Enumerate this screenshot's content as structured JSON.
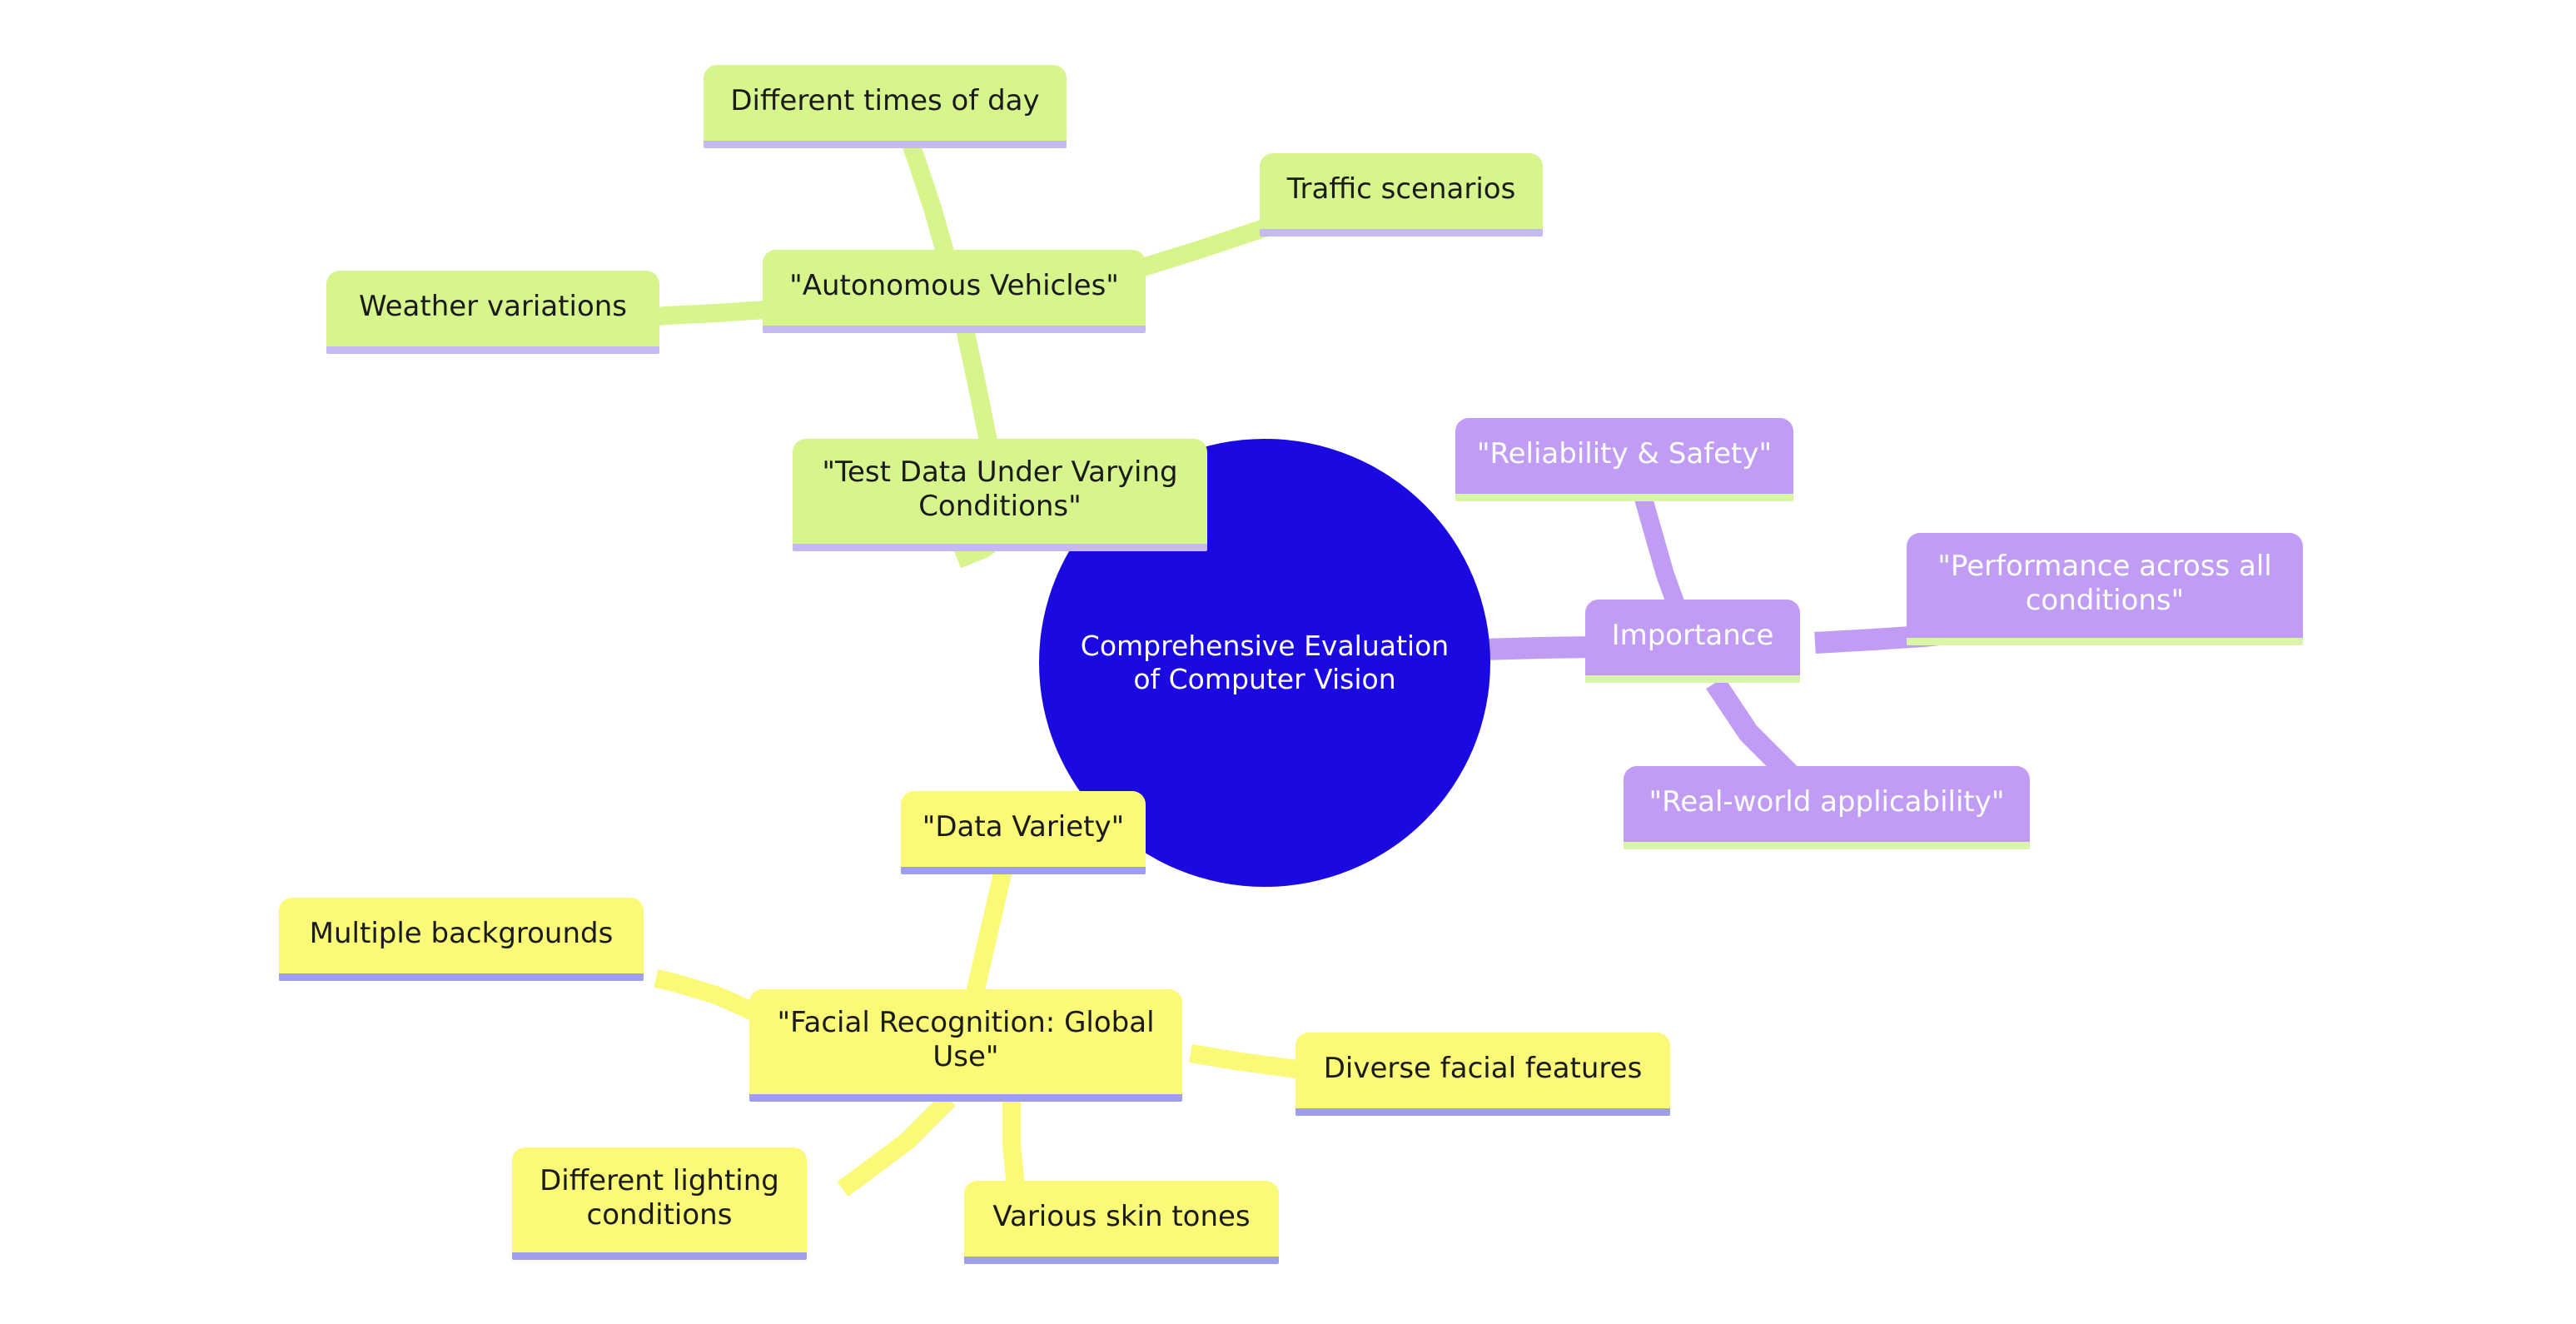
{
  "diagram": {
    "type": "mind-map",
    "background_color": "#ffffff",
    "root": {
      "label": "Comprehensive Evaluation\nof Computer Vision",
      "shape": "circle",
      "fill_color": "#1a09e0",
      "text_color": "#ffffff"
    },
    "branches": [
      {
        "id": "test-data",
        "label": "\"Test Data Under Varying\nConditions\"",
        "fill_color": "#d6f58c",
        "text_color": "#1a1a1a",
        "underline_color": "#c6b8f0",
        "children": [
          {
            "id": "autonomous-vehicles",
            "label": "\"Autonomous Vehicles\"",
            "children": [
              {
                "id": "different-times-of-day",
                "label": "Different times of day"
              },
              {
                "id": "traffic-scenarios",
                "label": "Traffic scenarios"
              },
              {
                "id": "weather-variations",
                "label": "Weather variations"
              }
            ]
          }
        ]
      },
      {
        "id": "data-variety",
        "label": "\"Data Variety\"",
        "fill_color": "#fafa78",
        "text_color": "#1a1a1a",
        "underline_color": "#9e9eea",
        "children": [
          {
            "id": "facial-recognition",
            "label": "\"Facial Recognition: Global\nUse\"",
            "children": [
              {
                "id": "multiple-backgrounds",
                "label": "Multiple backgrounds"
              },
              {
                "id": "diverse-facial-features",
                "label": "Diverse facial features"
              },
              {
                "id": "different-lighting-conditions",
                "label": "Different lighting\nconditions"
              },
              {
                "id": "various-skin-tones",
                "label": "Various skin tones"
              }
            ]
          }
        ]
      },
      {
        "id": "importance",
        "label": "Importance",
        "fill_color": "#c09cf5",
        "text_color": "#ffffff",
        "underline_color": "#d9f5a8",
        "children": [
          {
            "id": "reliability-safety",
            "label": "\"Reliability & Safety\""
          },
          {
            "id": "performance-across-all-conditions",
            "label": "\"Performance across all\nconditions\""
          },
          {
            "id": "real-world-applicability",
            "label": "\"Real-world applicability\""
          }
        ]
      }
    ]
  },
  "nodes": {
    "root": "Comprehensive Evaluation\nof Computer Vision",
    "different_times_of_day": "Different times of day",
    "traffic_scenarios": "Traffic scenarios",
    "weather_variations": "Weather variations",
    "autonomous_vehicles": "\"Autonomous Vehicles\"",
    "test_data_under_varying_conditions": "\"Test Data Under Varying\nConditions\"",
    "reliability_safety": "\"Reliability & Safety\"",
    "importance": "Importance",
    "performance_across_all_conditions": "\"Performance across all\nconditions\"",
    "real_world_applicability": "\"Real-world applicability\"",
    "data_variety": "\"Data Variety\"",
    "multiple_backgrounds": "Multiple backgrounds",
    "facial_recognition_global_use": "\"Facial Recognition: Global\nUse\"",
    "diverse_facial_features": "Diverse facial features",
    "different_lighting_conditions": "Different lighting\nconditions",
    "various_skin_tones": "Various skin tones"
  },
  "colors": {
    "root_fill": "#1a09e0",
    "green_fill": "#d6f58c",
    "green_underline": "#c6b8f0",
    "yellow_fill": "#fafa78",
    "yellow_underline": "#9e9eea",
    "purple_fill": "#c09cf5",
    "purple_underline": "#d9f5a8",
    "background": "#ffffff"
  }
}
